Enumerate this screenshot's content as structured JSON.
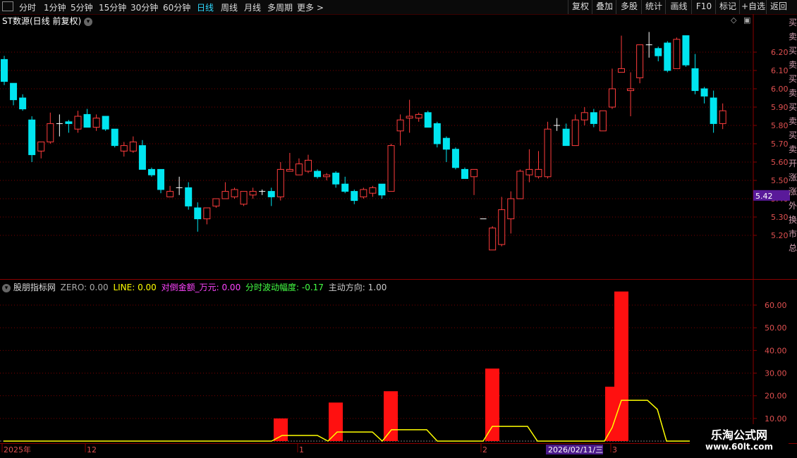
{
  "toolbar": {
    "left_items": [
      "分时",
      "1分钟",
      "5分钟",
      "15分钟",
      "30分钟",
      "60分钟",
      "日线",
      "周线",
      "月线",
      "多周期",
      "更多 >"
    ],
    "active": "日线",
    "right_items": [
      "复权",
      "叠加",
      "多股",
      "统计",
      "画线",
      "F10",
      "标记",
      "+自选",
      "返回"
    ]
  },
  "main_chart": {
    "title": "ST数源(日线 前复权)",
    "price_labels": [
      "6.20",
      "6.10",
      "6.00",
      "5.90",
      "5.80",
      "5.70",
      "5.60",
      "5.50",
      "5.40",
      "5.30",
      "5.20"
    ],
    "current_price": "5.42",
    "colors": {
      "up": "#ff3c3c",
      "down": "#00e5f0",
      "current_tag": "#5a1a9a",
      "grid": "#7a0000"
    }
  },
  "indicator": {
    "name": "股朋指标网",
    "params": [
      {
        "label": "ZERO: 0.00",
        "color": "#aaaaaa"
      },
      {
        "label": "LINE: 0.00",
        "color": "#ffff00"
      },
      {
        "label": "对倒金额_万元: 0.00",
        "color": "#ff44ff"
      },
      {
        "label": "分时波动幅度: -0.17",
        "color": "#44ff44"
      },
      {
        "label": "主动方向: 1.00",
        "color": "#cccccc"
      }
    ],
    "axis_labels": [
      "60.00",
      "50.00",
      "40.00",
      "30.00",
      "20.00",
      "10.00"
    ]
  },
  "date_axis": {
    "labels": [
      "2025年",
      "12",
      "1",
      "2",
      "3"
    ],
    "cursor_date": "2026/02/11/三"
  },
  "watermark": {
    "line1": "乐淘公式网",
    "line2": "www.60lt.com"
  },
  "right_panel_partial": "买 卖 买 卖 买 卖 买 卖 买 卖 开 涨 涨 外 换 市 总",
  "chart_data": {
    "type": "candlestick",
    "y_range": [
      5.1,
      6.26
    ],
    "candles": [
      {
        "o": 6.16,
        "h": 6.18,
        "l": 6.02,
        "c": 6.04
      },
      {
        "o": 6.03,
        "h": 6.03,
        "l": 5.91,
        "c": 5.94
      },
      {
        "o": 5.95,
        "h": 5.97,
        "l": 5.88,
        "c": 5.89
      },
      {
        "o": 5.83,
        "h": 5.85,
        "l": 5.6,
        "c": 5.64
      },
      {
        "o": 5.66,
        "h": 5.71,
        "l": 5.62,
        "c": 5.71
      },
      {
        "o": 5.71,
        "h": 5.87,
        "l": 5.7,
        "c": 5.81
      },
      {
        "o": 5.81,
        "h": 5.86,
        "l": 5.74,
        "c": 5.81
      },
      {
        "o": 5.82,
        "h": 5.83,
        "l": 5.76,
        "c": 5.81
      },
      {
        "o": 5.78,
        "h": 5.88,
        "l": 5.76,
        "c": 5.85
      },
      {
        "o": 5.86,
        "h": 5.89,
        "l": 5.79,
        "c": 5.79
      },
      {
        "o": 5.79,
        "h": 5.86,
        "l": 5.77,
        "c": 5.84
      },
      {
        "o": 5.85,
        "h": 5.85,
        "l": 5.77,
        "c": 5.78
      },
      {
        "o": 5.78,
        "h": 5.78,
        "l": 5.68,
        "c": 5.69
      },
      {
        "o": 5.66,
        "h": 5.71,
        "l": 5.63,
        "c": 5.69
      },
      {
        "o": 5.66,
        "h": 5.74,
        "l": 5.65,
        "c": 5.71
      },
      {
        "o": 5.69,
        "h": 5.72,
        "l": 5.56,
        "c": 5.56
      },
      {
        "o": 5.56,
        "h": 5.57,
        "l": 5.52,
        "c": 5.53
      },
      {
        "o": 5.56,
        "h": 5.56,
        "l": 5.43,
        "c": 5.45
      },
      {
        "o": 5.41,
        "h": 5.47,
        "l": 5.41,
        "c": 5.44
      },
      {
        "o": 5.46,
        "h": 5.52,
        "l": 5.42,
        "c": 5.46
      },
      {
        "o": 5.46,
        "h": 5.49,
        "l": 5.34,
        "c": 5.36
      },
      {
        "o": 5.35,
        "h": 5.38,
        "l": 5.22,
        "c": 5.29
      },
      {
        "o": 5.29,
        "h": 5.35,
        "l": 5.26,
        "c": 5.35
      },
      {
        "o": 5.36,
        "h": 5.4,
        "l": 5.35,
        "c": 5.4
      },
      {
        "o": 5.4,
        "h": 5.49,
        "l": 5.4,
        "c": 5.44
      },
      {
        "o": 5.41,
        "h": 5.46,
        "l": 5.4,
        "c": 5.45
      },
      {
        "o": 5.37,
        "h": 5.44,
        "l": 5.36,
        "c": 5.44
      },
      {
        "o": 5.42,
        "h": 5.46,
        "l": 5.4,
        "c": 5.44
      },
      {
        "o": 5.44,
        "h": 5.45,
        "l": 5.42,
        "c": 5.44
      },
      {
        "o": 5.44,
        "h": 5.46,
        "l": 5.36,
        "c": 5.41
      },
      {
        "o": 5.41,
        "h": 5.6,
        "l": 5.39,
        "c": 5.56
      },
      {
        "o": 5.55,
        "h": 5.65,
        "l": 5.55,
        "c": 5.56
      },
      {
        "o": 5.53,
        "h": 5.62,
        "l": 5.53,
        "c": 5.59
      },
      {
        "o": 5.55,
        "h": 5.64,
        "l": 5.54,
        "c": 5.61
      },
      {
        "o": 5.55,
        "h": 5.56,
        "l": 5.51,
        "c": 5.52
      },
      {
        "o": 5.52,
        "h": 5.54,
        "l": 5.5,
        "c": 5.53
      },
      {
        "o": 5.54,
        "h": 5.55,
        "l": 5.46,
        "c": 5.48
      },
      {
        "o": 5.48,
        "h": 5.52,
        "l": 5.43,
        "c": 5.44
      },
      {
        "o": 5.44,
        "h": 5.45,
        "l": 5.37,
        "c": 5.39
      },
      {
        "o": 5.41,
        "h": 5.46,
        "l": 5.4,
        "c": 5.45
      },
      {
        "o": 5.43,
        "h": 5.47,
        "l": 5.41,
        "c": 5.46
      },
      {
        "o": 5.48,
        "h": 5.48,
        "l": 5.4,
        "c": 5.42
      },
      {
        "o": 5.44,
        "h": 5.7,
        "l": 5.44,
        "c": 5.69
      },
      {
        "o": 5.77,
        "h": 5.86,
        "l": 5.69,
        "c": 5.83
      },
      {
        "o": 5.84,
        "h": 5.94,
        "l": 5.76,
        "c": 5.85
      },
      {
        "o": 5.84,
        "h": 5.87,
        "l": 5.82,
        "c": 5.86
      },
      {
        "o": 5.87,
        "h": 5.88,
        "l": 5.79,
        "c": 5.79
      },
      {
        "o": 5.81,
        "h": 5.82,
        "l": 5.68,
        "c": 5.7
      },
      {
        "o": 5.73,
        "h": 5.74,
        "l": 5.6,
        "c": 5.67
      },
      {
        "o": 5.67,
        "h": 5.68,
        "l": 5.56,
        "c": 5.57
      },
      {
        "o": 5.56,
        "h": 5.57,
        "l": 5.51,
        "c": 5.51
      },
      {
        "o": 5.52,
        "h": 5.56,
        "l": 5.42,
        "c": 5.56
      },
      {
        "o": 5.29,
        "h": 5.29,
        "l": 5.29,
        "c": 5.29
      },
      {
        "o": 5.12,
        "h": 5.25,
        "l": 5.12,
        "c": 5.24
      },
      {
        "o": 5.15,
        "h": 5.41,
        "l": 5.14,
        "c": 5.34
      },
      {
        "o": 5.29,
        "h": 5.44,
        "l": 5.21,
        "c": 5.4
      },
      {
        "o": 5.4,
        "h": 5.56,
        "l": 5.4,
        "c": 5.55
      },
      {
        "o": 5.53,
        "h": 5.67,
        "l": 5.49,
        "c": 5.56
      },
      {
        "o": 5.52,
        "h": 5.66,
        "l": 5.51,
        "c": 5.56
      },
      {
        "o": 5.52,
        "h": 5.82,
        "l": 5.51,
        "c": 5.78
      },
      {
        "o": 5.8,
        "h": 5.84,
        "l": 5.77,
        "c": 5.8
      },
      {
        "o": 5.78,
        "h": 5.81,
        "l": 5.69,
        "c": 5.69
      },
      {
        "o": 5.69,
        "h": 5.86,
        "l": 5.69,
        "c": 5.83
      },
      {
        "o": 5.83,
        "h": 5.9,
        "l": 5.8,
        "c": 5.87
      },
      {
        "o": 5.87,
        "h": 5.89,
        "l": 5.79,
        "c": 5.81
      },
      {
        "o": 5.77,
        "h": 5.88,
        "l": 5.77,
        "c": 5.88
      },
      {
        "o": 5.9,
        "h": 6.11,
        "l": 5.89,
        "c": 6.0
      },
      {
        "o": 6.09,
        "h": 6.29,
        "l": 6.09,
        "c": 6.11
      },
      {
        "o": 5.99,
        "h": 6.09,
        "l": 5.85,
        "c": 6.0
      },
      {
        "o": 6.06,
        "h": 6.24,
        "l": 6.03,
        "c": 6.24
      },
      {
        "o": 6.24,
        "h": 6.31,
        "l": 6.17,
        "c": 6.24
      },
      {
        "o": 6.22,
        "h": 6.23,
        "l": 6.15,
        "c": 6.18
      },
      {
        "o": 6.25,
        "h": 6.26,
        "l": 6.09,
        "c": 6.1
      },
      {
        "o": 6.11,
        "h": 6.28,
        "l": 6.11,
        "c": 6.27
      },
      {
        "o": 6.29,
        "h": 6.29,
        "l": 6.12,
        "c": 6.13
      },
      {
        "o": 6.11,
        "h": 6.19,
        "l": 5.97,
        "c": 5.99
      },
      {
        "o": 6.0,
        "h": 6.01,
        "l": 5.92,
        "c": 5.96
      },
      {
        "o": 5.95,
        "h": 5.99,
        "l": 5.76,
        "c": 5.81
      },
      {
        "o": 5.81,
        "h": 5.92,
        "l": 5.78,
        "c": 5.88
      }
    ],
    "indicator_bars": [
      {
        "x": 398,
        "value": 10
      },
      {
        "x": 476,
        "value": 17
      },
      {
        "x": 554,
        "value": 22
      },
      {
        "x": 698,
        "value": 32
      },
      {
        "x": 868,
        "value": 24
      },
      {
        "x": 881,
        "value": 66
      }
    ],
    "indicator_line": [
      [
        5,
        0
      ],
      [
        385,
        0
      ],
      [
        400,
        2.5
      ],
      [
        450,
        2.5
      ],
      [
        465,
        0
      ],
      [
        478,
        4
      ],
      [
        528,
        4
      ],
      [
        542,
        0
      ],
      [
        555,
        5
      ],
      [
        605,
        5
      ],
      [
        620,
        0
      ],
      [
        685,
        0
      ],
      [
        698,
        6.5
      ],
      [
        748,
        6.5
      ],
      [
        762,
        0
      ],
      [
        857,
        0
      ],
      [
        868,
        6
      ],
      [
        881,
        18
      ],
      [
        918,
        18
      ],
      [
        932,
        14
      ],
      [
        945,
        0
      ],
      [
        1068,
        0
      ]
    ],
    "indicator_y_range": [
      0,
      69
    ]
  }
}
